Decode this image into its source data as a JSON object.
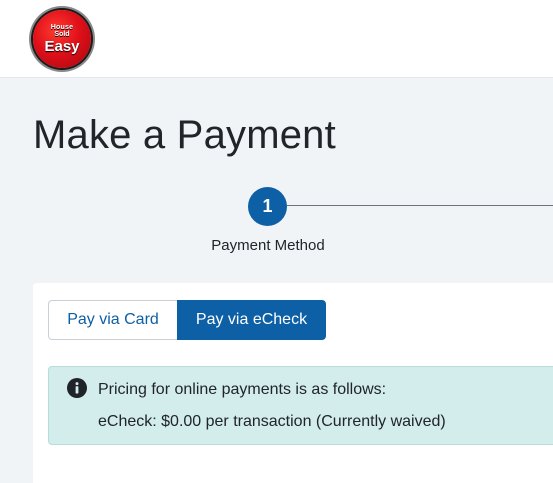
{
  "brand": {
    "logo_line1": "House",
    "logo_line2": "Sold",
    "logo_line3": "Easy"
  },
  "page": {
    "title": "Make a Payment"
  },
  "stepper": {
    "steps": [
      {
        "number": "1",
        "label": "Payment Method"
      }
    ]
  },
  "payment_method": {
    "options": [
      {
        "label": "Pay via Card",
        "selected": false
      },
      {
        "label": "Pay via eCheck",
        "selected": true
      }
    ]
  },
  "alert": {
    "icon": "info-circle-icon",
    "line1": "Pricing for online payments is as follows:",
    "line2": "eCheck: $0.00 per transaction (Currently waived)"
  },
  "colors": {
    "primary": "#0d5fa6",
    "page_bg": "#f1f4f7",
    "alert_bg": "#d3ecec",
    "logo_red": "#e0101a"
  }
}
